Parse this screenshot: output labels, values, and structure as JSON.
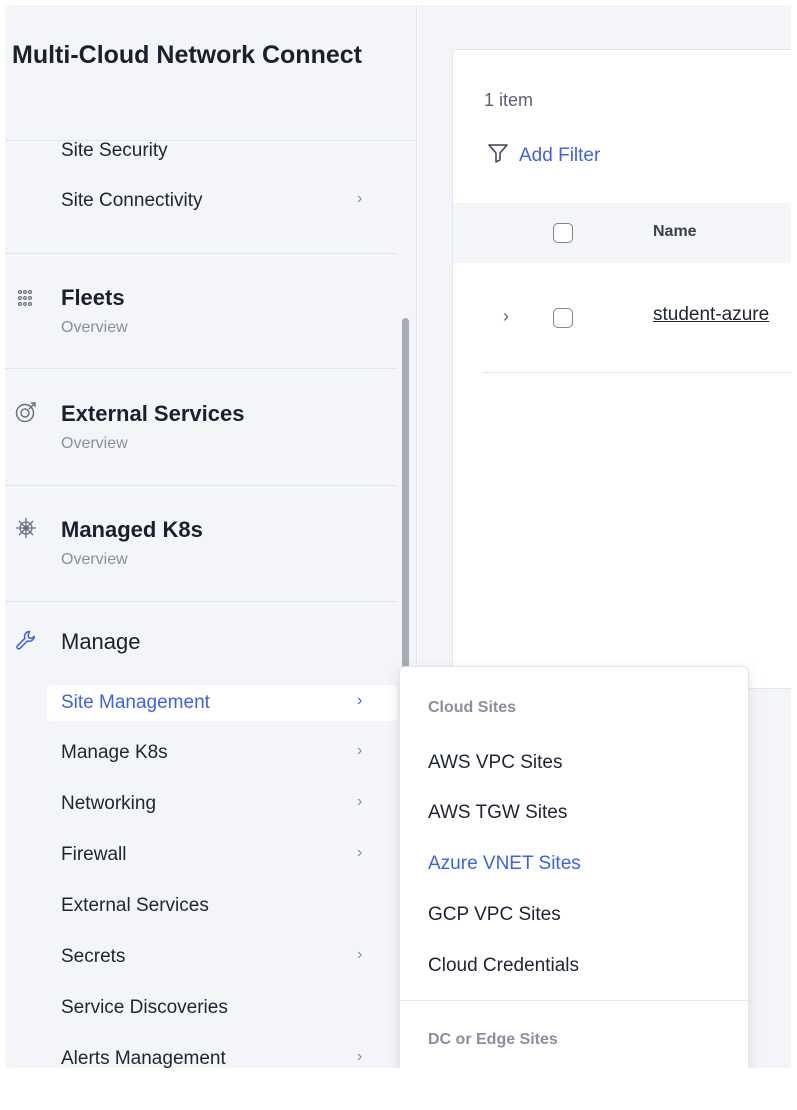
{
  "sidebar": {
    "app_title": "Multi-Cloud Network Connect",
    "top_items": [
      {
        "label": "Site Security",
        "has_chevron": false
      },
      {
        "label": "Site Connectivity",
        "has_chevron": true
      }
    ],
    "sections": [
      {
        "title": "Fleets",
        "subtitle": "Overview",
        "icon": "fleets-icon"
      },
      {
        "title": "External Services",
        "subtitle": "Overview",
        "icon": "external-services-icon"
      },
      {
        "title": "Managed K8s",
        "subtitle": "Overview",
        "icon": "helm-wheel-icon"
      }
    ],
    "manage": {
      "title": "Manage",
      "icon": "wrench-icon",
      "items": [
        {
          "label": "Site Management",
          "has_chevron": true,
          "active": true
        },
        {
          "label": "Manage K8s",
          "has_chevron": true
        },
        {
          "label": "Networking",
          "has_chevron": true
        },
        {
          "label": "Firewall",
          "has_chevron": true
        },
        {
          "label": "External Services",
          "has_chevron": false
        },
        {
          "label": "Secrets",
          "has_chevron": true
        },
        {
          "label": "Service Discoveries",
          "has_chevron": false
        },
        {
          "label": "Alerts Management",
          "has_chevron": true
        }
      ]
    },
    "chevron_glyph": "›"
  },
  "main": {
    "item_count": "1 item",
    "add_filter_label": "Add Filter",
    "table": {
      "columns": [
        "Name"
      ],
      "rows": [
        {
          "name": "student-azure"
        }
      ]
    }
  },
  "flyout": {
    "group_cloud": "Cloud Sites",
    "cloud_items": [
      {
        "label": "AWS VPC Sites"
      },
      {
        "label": "AWS TGW Sites"
      },
      {
        "label": "Azure VNET Sites",
        "highlight": true
      },
      {
        "label": "GCP VPC Sites"
      },
      {
        "label": "Cloud Credentials"
      }
    ],
    "group_dc": "DC or Edge Sites"
  },
  "colors": {
    "accent": "#3d63e0",
    "sidebar_bg": "#f4f5f8",
    "muted_text": "#8a8f9e"
  }
}
